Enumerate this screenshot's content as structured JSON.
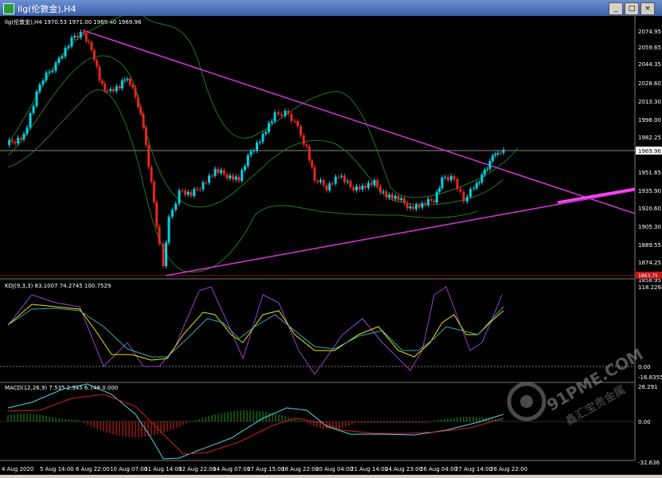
{
  "window": {
    "title": "llg(伦敦金),H4",
    "buttons": {
      "minimize": "_",
      "maximize": "□",
      "close": "×"
    }
  },
  "main_panel": {
    "label": "llg(伦敦金),H4  1970.53 1971.00 1969.40 1969.96",
    "price_ticks": [
      "2074.95",
      "2059.65",
      "2044.35",
      "2028.60",
      "2013.30",
      "1998.00",
      "1982.25",
      "1951.65",
      "1935.90",
      "1920.60",
      "1905.30",
      "1889.55",
      "1874.25",
      "1858.95"
    ],
    "current_price": "1969.96",
    "low_marker": "1863.75"
  },
  "kdj_panel": {
    "label": "KDJ(9,3,3) 83.1007 74.2745 100.7529",
    "ticks": [
      "118.2268",
      "0.00",
      "-16.8355"
    ]
  },
  "macd_panel": {
    "label": "MACD(12,26,9) 7.535 2.345 6.748 0.000",
    "ticks": [
      "28.291",
      "0.00",
      "-32.636"
    ]
  },
  "time_axis": [
    "4 Aug 2020",
    "5 Aug 14:00",
    "6 Aug 22:00",
    "10 Aug 07:00",
    "11 Aug 14:00",
    "12 Aug 22:00",
    "14 Aug 07:00",
    "17 Aug 15:00",
    "18 Aug 22:00",
    "20 Aug 04:00",
    "21 Aug 14:00",
    "24 Aug 23:00",
    "26 Aug 04:00",
    "27 Aug 14:00",
    "28 Aug 22:00"
  ],
  "watermark": {
    "brand": "91PME.COM",
    "cn": "鑫汇宝贵金属"
  },
  "colors": {
    "bull": "#00d2e6",
    "bear": "#e6261e",
    "trendline": "#cc33cc",
    "bands": "#1d7a1d",
    "k_line": "#9a3fd0",
    "d_line": "#e6e600",
    "j_line": "#3aa9a9",
    "macd_line": "#4fd4e6",
    "signal": "#d01e1e",
    "hist_up": "#1f9a1f",
    "hist_down": "#e6261e"
  }
}
